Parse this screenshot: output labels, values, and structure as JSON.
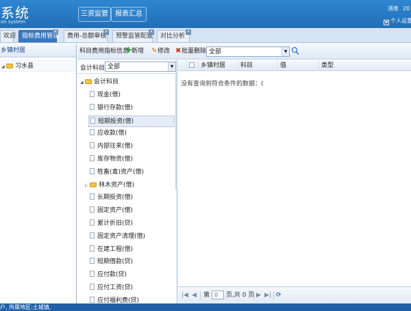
{
  "header": {
    "title": "系统",
    "subtitle": "on system",
    "buttons": [
      "三资监管",
      "报表汇总"
    ],
    "right_top": "消息",
    "right_year": "20",
    "user_settings": "个人设置"
  },
  "tabs": [
    {
      "label": "欢迎",
      "active": false,
      "closable": false
    },
    {
      "label": "指标费用管理",
      "active": true,
      "closable": true
    },
    {
      "label": "费用-总额审核",
      "active": false,
      "closable": true
    },
    {
      "label": "预警监管配置",
      "active": false,
      "closable": true
    },
    {
      "label": "对比分析",
      "active": false,
      "closable": true
    }
  ],
  "left_panel": {
    "title": "乡镇村居",
    "tree": [
      {
        "label": "习水县"
      }
    ]
  },
  "toolbar": {
    "title": "科目费用指标信息",
    "add": "新增",
    "edit": "修改",
    "batch_delete": "批量删除",
    "select_value": "全部"
  },
  "subject_filter": {
    "label": "会计科目",
    "value": "全部"
  },
  "subject_tree": {
    "root": "会计科目",
    "items": [
      {
        "label": "现金(借)",
        "type": "leaf"
      },
      {
        "label": "银行存款(借)",
        "type": "leaf"
      },
      {
        "label": "短期投资(借)",
        "type": "leaf",
        "selected": true
      },
      {
        "label": "应收款(借)",
        "type": "leaf"
      },
      {
        "label": "内部往来(借)",
        "type": "leaf"
      },
      {
        "label": "库存物资(借)",
        "type": "leaf"
      },
      {
        "label": "牲畜(禽)资产(借)",
        "type": "leaf"
      },
      {
        "label": "林木资产(借)",
        "type": "folder"
      },
      {
        "label": "长期投资(借)",
        "type": "leaf"
      },
      {
        "label": "固定资产(借)",
        "type": "leaf"
      },
      {
        "label": "累计折旧(贷)",
        "type": "leaf"
      },
      {
        "label": "固定资产清理(借)",
        "type": "leaf"
      },
      {
        "label": "在建工程(借)",
        "type": "leaf"
      },
      {
        "label": "短期借款(贷)",
        "type": "leaf"
      },
      {
        "label": "应付款(贷)",
        "type": "leaf"
      },
      {
        "label": "应付工资(贷)",
        "type": "leaf"
      },
      {
        "label": "应付福利费(贷)",
        "type": "leaf"
      }
    ]
  },
  "grid": {
    "columns": [
      "乡镇村居",
      "科目",
      "值",
      "类型"
    ],
    "empty_text": "没有查询到符合条件的数据：("
  },
  "pager": {
    "page_label": "第",
    "page_value": "0",
    "total_label": "页,共 0 页"
  },
  "status_bar": "户, 所属地区:土城镇,"
}
